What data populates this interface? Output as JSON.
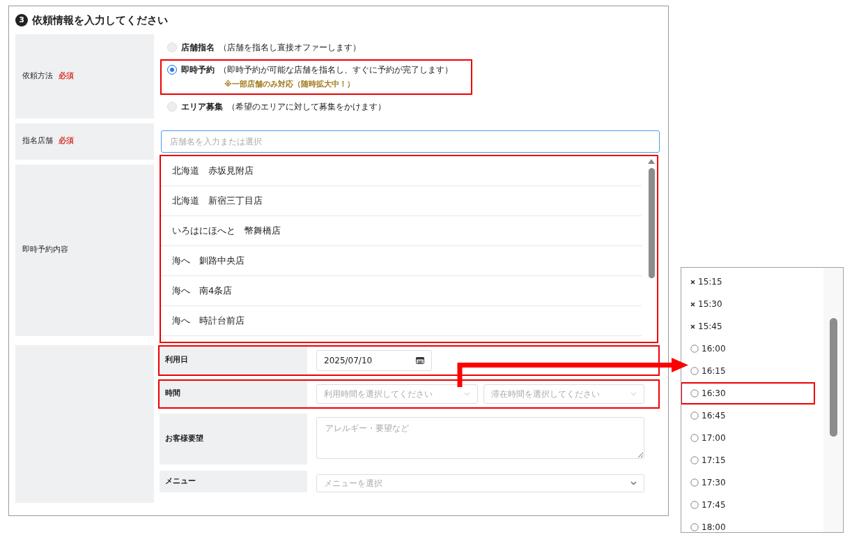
{
  "section": {
    "number": "3",
    "title": "依頼情報を入力してください"
  },
  "request_method": {
    "label": "依頼方法",
    "required": "必須",
    "options": [
      {
        "label": "店舗指名",
        "description": "（店舗を指名し直接オファーします）",
        "selected": false,
        "highlighted": false
      },
      {
        "label": "即時予約",
        "description": "（即時予約が可能な店舗を指名し、すぐに予約が完了します）",
        "note": "※一部店舗のみ対応（随時拡大中！）",
        "selected": true,
        "highlighted": true
      },
      {
        "label": "エリア募集",
        "description": "（希望のエリアに対して募集をかけます）",
        "selected": false,
        "highlighted": false
      }
    ]
  },
  "store": {
    "label": "指名店舗",
    "required": "必須",
    "placeholder": "店舗名を入力または選択"
  },
  "store_list": {
    "highlighted": true,
    "items": [
      "北海道　赤坂見附店",
      "北海道　新宿三丁目店",
      "いろはにほへと　幣舞橋店",
      "海へ　釧路中央店",
      "海へ　南4条店",
      "海へ　時計台前店"
    ]
  },
  "instant": {
    "label": "即時予約内容",
    "fields": [
      {
        "kind": "date",
        "label": "利用日",
        "value": "2025/07/10",
        "highlighted": true
      },
      {
        "kind": "selects",
        "label": "時間",
        "placeholders": [
          "利用時間を選択してください",
          "滞在時間を選択してください"
        ],
        "highlighted": true
      },
      {
        "kind": "textarea",
        "label": "お客様要望",
        "placeholder": "アレルギー・要望など",
        "highlighted": false
      },
      {
        "kind": "select",
        "label": "メニュー",
        "placeholder": "メニューを選択",
        "highlighted": false
      }
    ]
  },
  "time_slots": [
    {
      "time": "15:15",
      "available": false,
      "highlighted": false
    },
    {
      "time": "15:30",
      "available": false,
      "highlighted": false
    },
    {
      "time": "15:45",
      "available": false,
      "highlighted": false
    },
    {
      "time": "16:00",
      "available": true,
      "highlighted": false
    },
    {
      "time": "16:15",
      "available": true,
      "highlighted": false
    },
    {
      "time": "16:30",
      "available": true,
      "highlighted": true
    },
    {
      "time": "16:45",
      "available": true,
      "highlighted": false
    },
    {
      "time": "17:00",
      "available": true,
      "highlighted": false
    },
    {
      "time": "17:15",
      "available": true,
      "highlighted": false
    },
    {
      "time": "17:30",
      "available": true,
      "highlighted": false
    },
    {
      "time": "17:45",
      "available": true,
      "highlighted": false
    },
    {
      "time": "18:00",
      "available": true,
      "highlighted": false
    }
  ]
}
